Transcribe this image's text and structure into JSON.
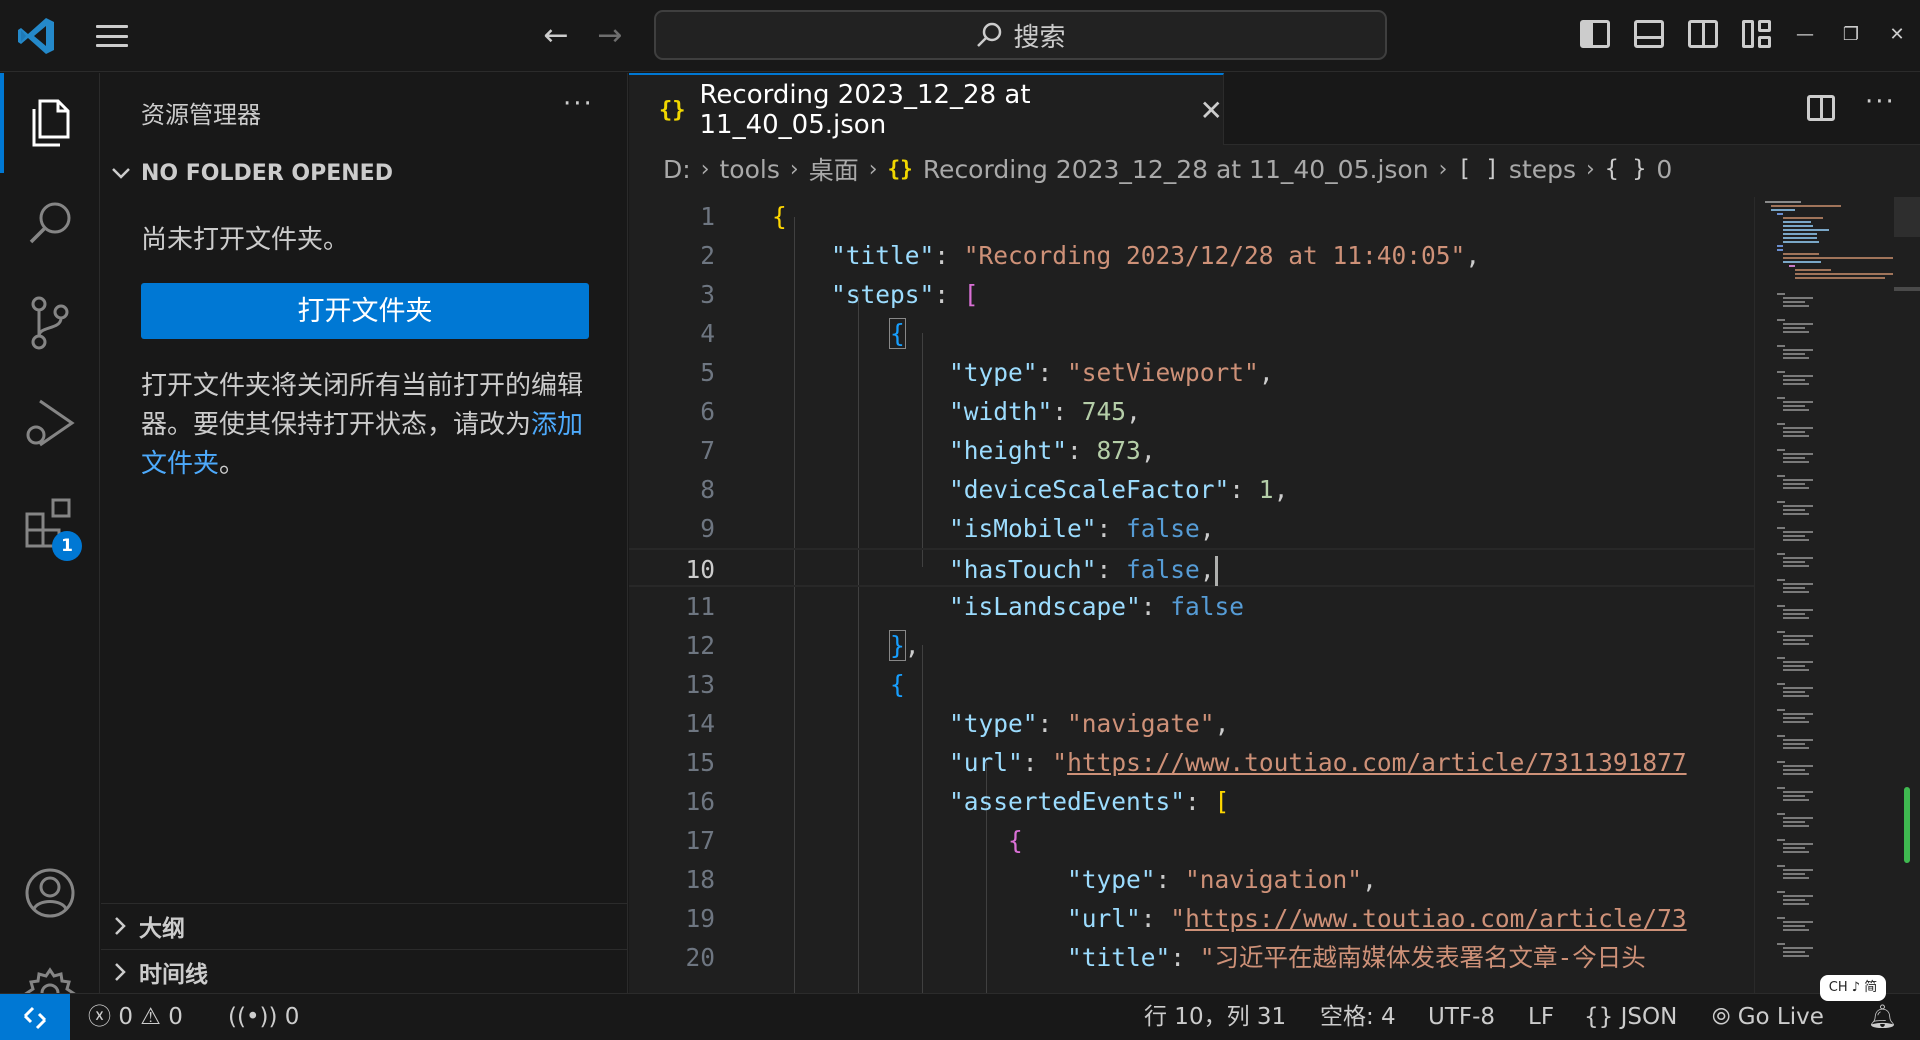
{
  "titlebar": {
    "search_placeholder": "搜索",
    "back_arrow": "←",
    "forward_arrow": "→"
  },
  "activity_bar": {
    "items": [
      "explorer-icon",
      "search-icon",
      "source-control-icon",
      "run-debug-icon",
      "extensions-icon"
    ],
    "extensions_badge": "1",
    "bottom_items": [
      "account-icon",
      "settings-gear-icon"
    ]
  },
  "sidebar": {
    "title": "资源管理器",
    "more": "···",
    "section": "NO FOLDER OPENED",
    "no_folder_msg": "尚未打开文件夹。",
    "open_folder_button": "打开文件夹",
    "info_text": "打开文件夹将关闭所有当前打开的编辑器。要使其保持打开状态，请改为",
    "info_link": "添加文件夹",
    "info_end": "。",
    "outline": "大纲",
    "timeline": "时间线"
  },
  "editor": {
    "tab": {
      "icon": "{}",
      "name": "Recording 2023_12_28 at 11_40_05.json",
      "close": "✕"
    },
    "breadcrumb": {
      "drive": "D:",
      "folder1": "tools",
      "folder2": "桌面",
      "file_icon": "{}",
      "file": "Recording 2023_12_28 at 11_40_05.json",
      "arr_icon": "[ ]",
      "steps": "steps",
      "obj_icon": "{ }",
      "index": "0"
    },
    "line_numbers": [
      "1",
      "2",
      "3",
      "4",
      "5",
      "6",
      "7",
      "8",
      "9",
      "10",
      "11",
      "12",
      "13",
      "14",
      "15",
      "16",
      "17",
      "18",
      "19",
      "20"
    ],
    "current_line": "10",
    "code": {
      "l1_open": "{",
      "l2_key": "\"title\"",
      "l2_val": "\"Recording 2023/12/28 at 11:40:05\"",
      "l3_key": "\"steps\"",
      "l3_open": "[",
      "l4_open": "{",
      "l5_key": "\"type\"",
      "l5_val": "\"setViewport\"",
      "l6_key": "\"width\"",
      "l6_val": "745",
      "l7_key": "\"height\"",
      "l7_val": "873",
      "l8_key": "\"deviceScaleFactor\"",
      "l8_val": "1",
      "l9_key": "\"isMobile\"",
      "l9_val": "false",
      "l10_key": "\"hasTouch\"",
      "l10_val": "false",
      "l11_key": "\"isLandscape\"",
      "l11_val": "false",
      "l12_close": "}",
      "l13_open": "{",
      "l14_key": "\"type\"",
      "l14_val": "\"navigate\"",
      "l15_key": "\"url\"",
      "l15_q": "\"",
      "l15_val": "https://www.toutiao.com/article/7311391877",
      "l16_key": "\"assertedEvents\"",
      "l16_open": "[",
      "l17_open": "{",
      "l18_key": "\"type\"",
      "l18_val": "\"navigation\"",
      "l19_key": "\"url\"",
      "l19_q": "\"",
      "l19_val": "https://www.toutiao.com/article/73",
      "l20_key": "\"title\"",
      "l20_val": "\"习近平在越南媒体发表署名文章-今日头"
    }
  },
  "statusbar": {
    "errors": "0",
    "warnings": "0",
    "ports": "0",
    "position": "行 10，列 31",
    "spaces": "空格: 4",
    "encoding": "UTF-8",
    "eol": "LF",
    "lang_icon": "{}",
    "language": "JSON",
    "golive": "Go Live"
  },
  "watermark": "CH ♪ 简",
  "colors": {
    "accent": "#0078d4",
    "string": "#ce9178",
    "key": "#9cdcfe",
    "number": "#b5cea8",
    "boolean": "#569cd6"
  }
}
